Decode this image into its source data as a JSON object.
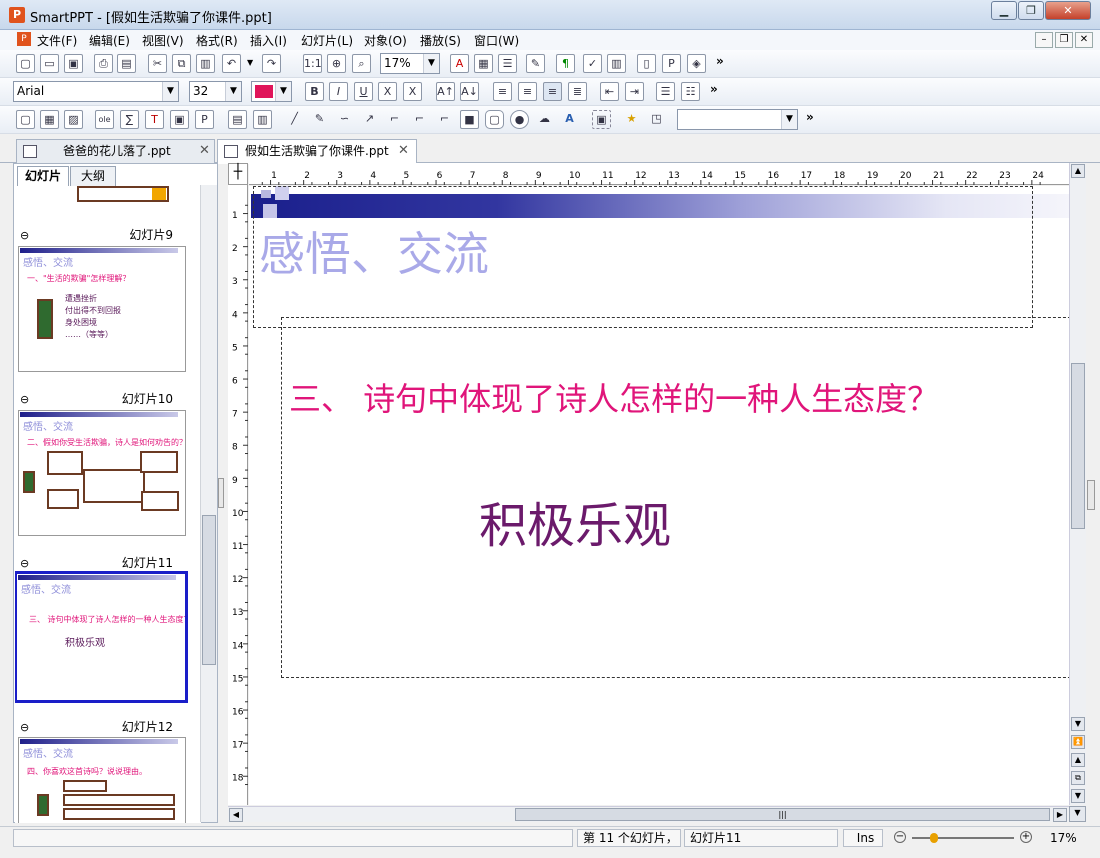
{
  "window": {
    "app_icon": "P",
    "title": "SmartPPT - [假如生活欺骗了你课件.ppt]",
    "minimize_icon": "minimize-icon",
    "maximize_icon": "maximize-icon",
    "close_icon": "close-icon"
  },
  "menu": [
    "文件(F)",
    "编辑(E)",
    "视图(V)",
    "格式(R)",
    "插入(I)",
    "幻灯片(L)",
    "对象(O)",
    "播放(S)",
    "窗口(W)"
  ],
  "toolbar": {
    "zoom": "17%",
    "font": "Arial",
    "font_size": "32",
    "color_swatch": "#e0155a",
    "more": "»"
  },
  "tabs": [
    {
      "label": "爸爸的花儿落了.ppt",
      "active": false
    },
    {
      "label": "假如生活欺骗了你课件.ppt",
      "active": true
    }
  ],
  "left_panel": {
    "tabs": [
      "幻灯片",
      "大纲"
    ],
    "slides": [
      {
        "label": "幻灯片9",
        "title": "感悟、交流",
        "question": "一、\"生活的欺骗\"怎样理解？",
        "lines": [
          "遭遇挫折",
          "付出得不到回报",
          "身处困境",
          "……（等等）"
        ]
      },
      {
        "label": "幻灯片10",
        "title": "感悟、交流",
        "question": "二、假如你受生活欺骗，诗人是如何劝告的？"
      },
      {
        "label": "幻灯片11",
        "title": "感悟、交流",
        "question": "三、 诗句中体现了诗人怎样的一种人生态度？",
        "answer": "积极乐观"
      },
      {
        "label": "幻灯片12",
        "title": "感悟、交流",
        "question": "四、你喜欢这首诗吗？说说理由。"
      }
    ]
  },
  "ruler": {
    "h": [
      "1",
      "2",
      "3",
      "4",
      "5",
      "6",
      "7",
      "8",
      "9",
      "10",
      "11",
      "12",
      "13",
      "14",
      "15",
      "16",
      "17",
      "18",
      "19",
      "20",
      "21",
      "22",
      "23",
      "24"
    ],
    "v": [
      "1",
      "2",
      "3",
      "4",
      "5",
      "6",
      "7",
      "8",
      "9",
      "10",
      "11",
      "12",
      "13",
      "14",
      "15",
      "16",
      "17",
      "18"
    ]
  },
  "slide": {
    "title": "感悟、交流",
    "question": "三、 诗句中体现了诗人怎样的一种人生态度？",
    "answer": "积极乐观"
  },
  "status": {
    "slide_pos": "第 11 个幻灯片，",
    "slide_name": "幻灯片11",
    "ins": "Ins",
    "zoom": "17%"
  }
}
